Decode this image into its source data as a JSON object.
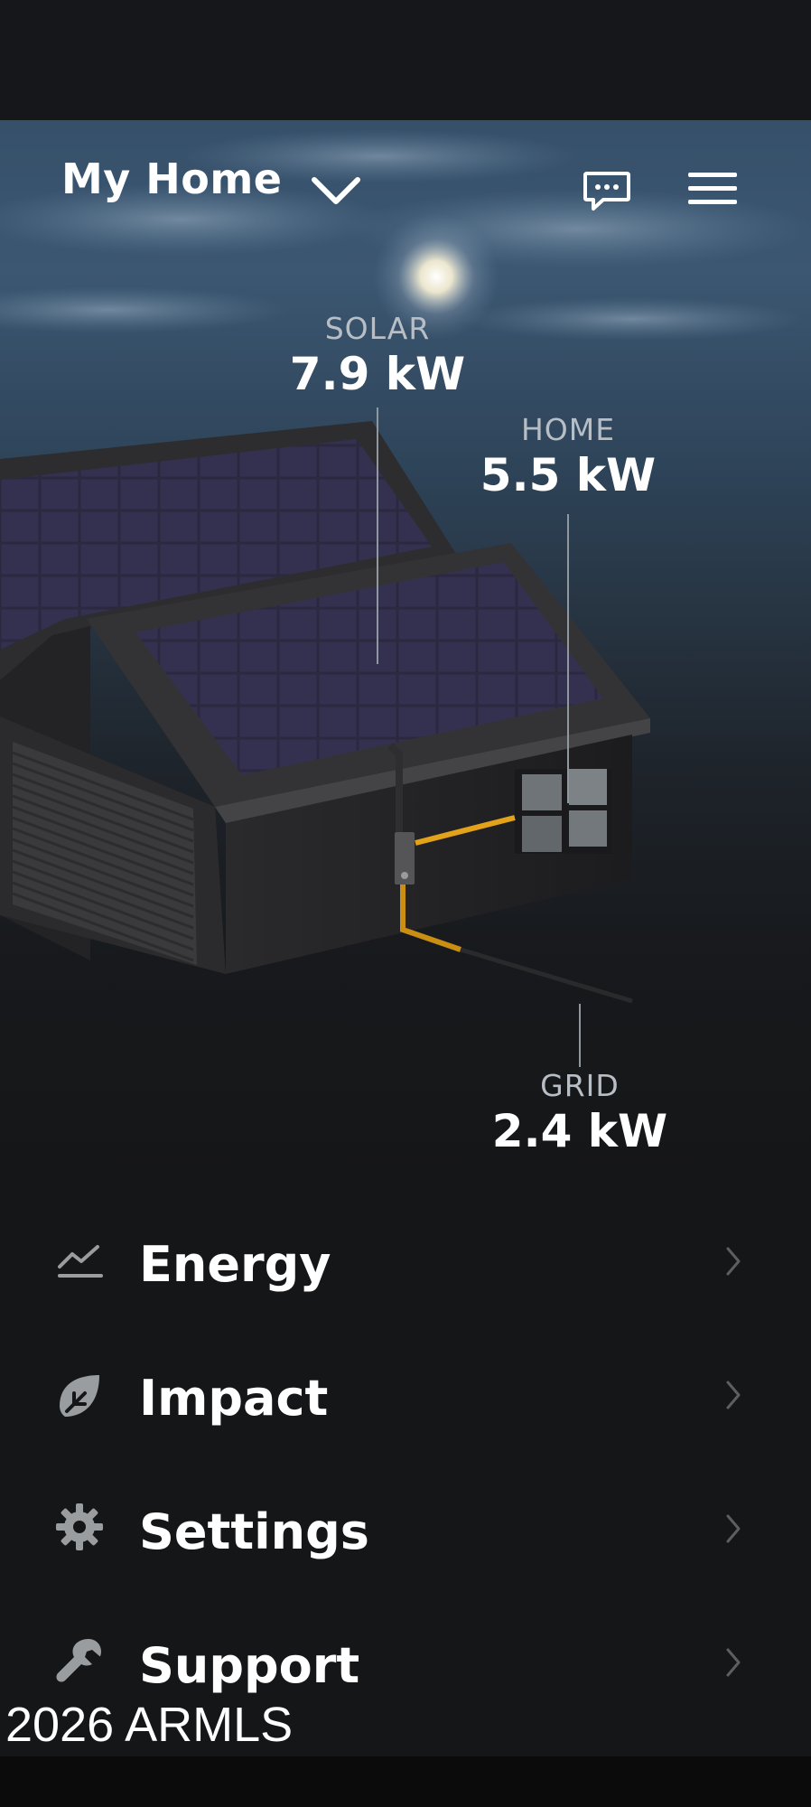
{
  "header": {
    "title": "My Home",
    "dropdown_icon": "chevron-down-icon",
    "messages_icon": "chat-bubble-icon",
    "menu_icon": "hamburger-menu-icon"
  },
  "power_flow": {
    "solar": {
      "label": "SOLAR",
      "value": "7.9 kW"
    },
    "home": {
      "label": "HOME",
      "value": "5.5 kW"
    },
    "grid": {
      "label": "GRID",
      "value": "2.4 kW"
    }
  },
  "menu": {
    "items": [
      {
        "label": "Energy",
        "icon": "chart-line-icon"
      },
      {
        "label": "Impact",
        "icon": "leaf-icon"
      },
      {
        "label": "Settings",
        "icon": "gear-icon"
      },
      {
        "label": "Support",
        "icon": "wrench-icon"
      }
    ]
  },
  "watermark": "2026 ARMLS",
  "colors": {
    "accent_wire": "#e2a21a",
    "text": "#ffffff",
    "muted": "#8a8d90"
  }
}
